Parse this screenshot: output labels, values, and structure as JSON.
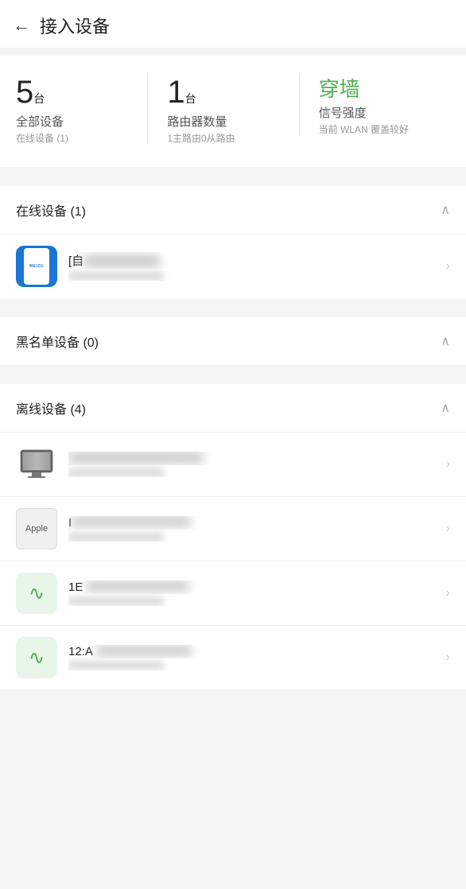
{
  "header": {
    "back_label": "←",
    "title": "接入设备"
  },
  "stats": [
    {
      "id": "all-devices",
      "number": "5",
      "unit": "台",
      "label": "全部设备",
      "sublabel": "在线设备 (1)"
    },
    {
      "id": "router-count",
      "number": "1",
      "unit": "台",
      "label": "路由器数量",
      "sublabel": "1主路由0从路由"
    },
    {
      "id": "signal-strength",
      "number": "穿墙",
      "unit": "",
      "label": "信号强度",
      "sublabel": "当前 WLAN 覆盖较好",
      "green": true
    }
  ],
  "sections": [
    {
      "id": "online",
      "title": "在线设备 (1)",
      "expanded": true,
      "devices": [
        {
          "id": "meizu-device",
          "type": "meizu",
          "name": "[自动]",
          "name_blurred": true,
          "sub_blurred": true
        }
      ]
    },
    {
      "id": "blacklist",
      "title": "黑名单设备 (0)",
      "expanded": true,
      "devices": []
    },
    {
      "id": "offline",
      "title": "离线设备 (4)",
      "expanded": true,
      "devices": [
        {
          "id": "monitor-device",
          "type": "monitor",
          "name_blurred": true,
          "sub_blurred": true
        },
        {
          "id": "apple-device",
          "type": "apple",
          "name_blurred": true,
          "sub_blurred": true
        },
        {
          "id": "wifi-device-1",
          "type": "wifi",
          "name": "1E",
          "name_blurred": true,
          "sub_blurred": false
        },
        {
          "id": "wifi-device-2",
          "type": "wifi",
          "name": "12:A",
          "name_blurred": true,
          "sub_blurred": false
        }
      ]
    }
  ],
  "icons": {
    "back": "←",
    "chevron_up": "∧",
    "arrow_right": "›",
    "wifi": "wifi"
  }
}
